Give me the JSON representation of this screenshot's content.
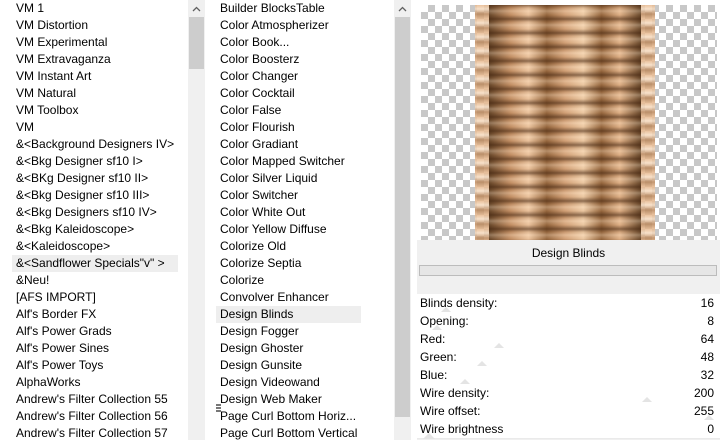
{
  "filter_categories": [
    "VM 1",
    "VM Distortion",
    "VM Experimental",
    "VM Extravaganza",
    "VM Instant Art",
    "VM Natural",
    "VM Toolbox",
    "VM",
    "&<Background Designers IV>",
    "&<Bkg Designer sf10 I>",
    "&<BKg Designer sf10 II>",
    "&<Bkg Designer sf10 III>",
    "&<Bkg Designers sf10 IV>",
    "&<Bkg Kaleidoscope>",
    "&<Kaleidoscope>",
    "&<Sandflower Specials\"v\" >",
    "&Neu!",
    "[AFS IMPORT]",
    "Alf's Border FX",
    "Alf's Power Grads",
    "Alf's Power Sines",
    "Alf's Power Toys",
    "AlphaWorks",
    "Andrew's Filter Collection 55",
    "Andrew's Filter Collection 56",
    "Andrew's Filter Collection 57"
  ],
  "selected_category_index": 15,
  "filters": [
    "Builder BlocksTable",
    "Color Atmospherizer",
    "Color Book...",
    "Color Boosterz",
    "Color Changer",
    "Color Cocktail",
    "Color False",
    "Color Flourish",
    "Color Gradiant",
    "Color Mapped Switcher",
    "Color Silver Liquid",
    "Color Switcher",
    "Color White Out",
    "Color Yellow Diffuse",
    "Colorize Old",
    "Colorize Septia",
    "Colorize",
    "Convolver Enhancer",
    "Design Blinds",
    "Design Fogger",
    "Design Ghoster",
    "Design Gunsite",
    "Design Videowand",
    "Design Web Maker",
    "Page Curl Bottom Horiz...",
    "Page Curl Bottom Vertical"
  ],
  "selected_filter_index": 18,
  "filter_title": "Design Blinds",
  "parameters": [
    {
      "label": "Blinds density:",
      "value": "16",
      "level": 0.06
    },
    {
      "label": "Opening:",
      "value": "8",
      "level": 0.03
    },
    {
      "label": "Red:",
      "value": "64",
      "level": 0.25
    },
    {
      "label": "Green:",
      "value": "48",
      "level": 0.19
    },
    {
      "label": "Blue:",
      "value": "32",
      "level": 0.13
    },
    {
      "label": "Wire density:",
      "value": "200",
      "level": 0.78
    },
    {
      "label": "Wire offset:",
      "value": "255",
      "level": 1.0
    },
    {
      "label": "Wire brightness",
      "value": "0",
      "level": 0.0
    }
  ],
  "icons": {
    "scroll_up": "chevron-up-icon",
    "scroll_down": "chevron-down-icon",
    "drag_handle": "grip-icon"
  },
  "colors": {
    "selection": "#eeeeee",
    "scroll_thumb": "#cdcdcd",
    "panel_bg": "#f0f0f0"
  }
}
